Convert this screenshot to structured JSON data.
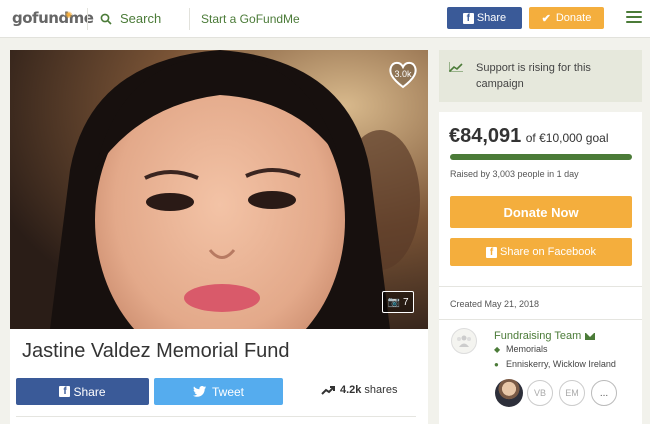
{
  "header": {
    "logo": "gofundme",
    "search_label": "Search",
    "start_label": "Start a GoFundMe",
    "share_label": "Share",
    "donate_label": "Donate"
  },
  "campaign": {
    "title": "Jastine Valdez Memorial Fund",
    "hearts": "3.0k",
    "photo_count": "7",
    "share_label": "Share",
    "tweet_label": "Tweet",
    "shares_count": "4.2k",
    "shares_label": "shares"
  },
  "support": {
    "text": "Support is rising for this campaign"
  },
  "donation": {
    "raised": "€84,091",
    "goal_text": "of €10,000 goal",
    "progress_fraction": 1.0,
    "raised_by": "Raised by 3,003 people in 1 day",
    "donate_now": "Donate Now",
    "share_facebook": "Share on Facebook",
    "created": "Created May 21, 2018"
  },
  "team": {
    "name": "Fundraising Team",
    "category": "Memorials",
    "location": "Enniskerry, Wicklow Ireland",
    "members": [
      "VB",
      "EM"
    ],
    "more": "..."
  },
  "colors": {
    "brand_green": "#4b7b38",
    "facebook_blue": "#3a5a98",
    "twitter_blue": "#55acee",
    "donate_orange": "#f4ae3d"
  }
}
